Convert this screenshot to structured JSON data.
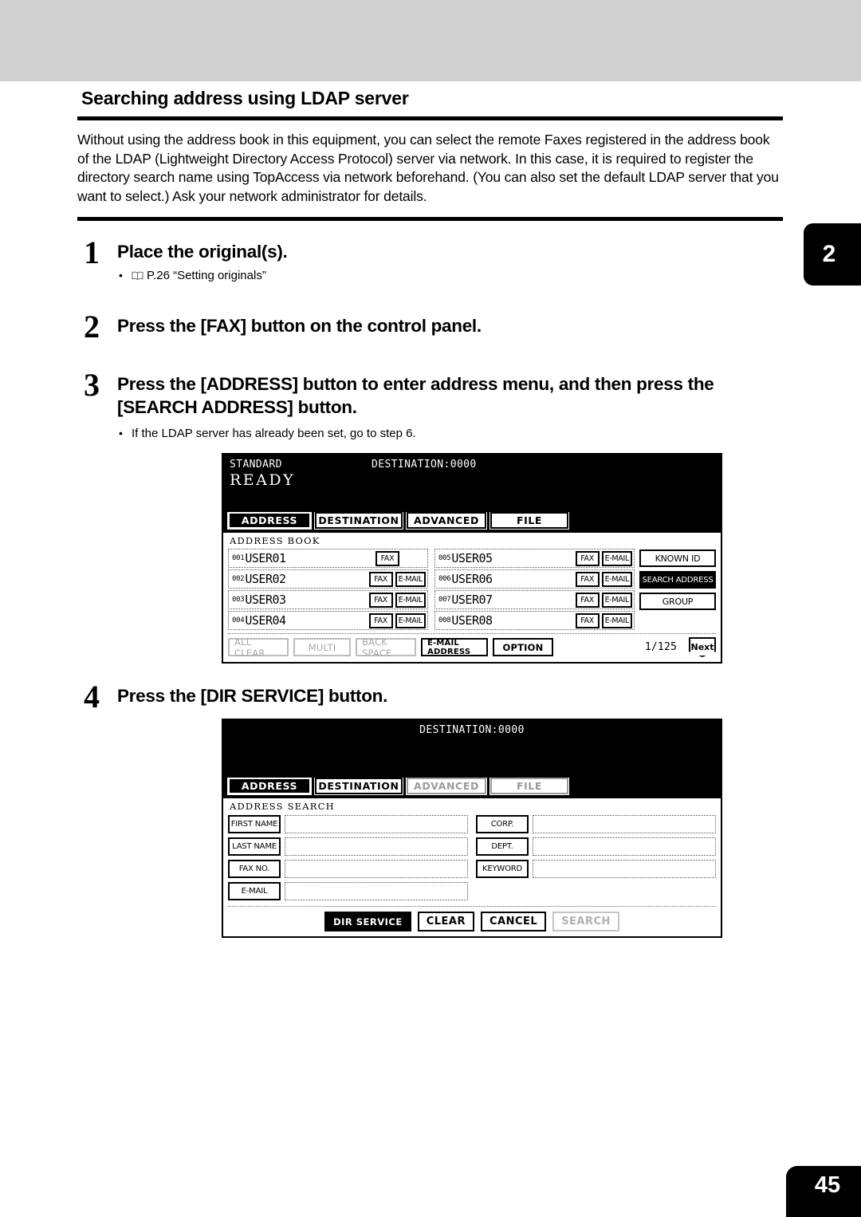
{
  "page": {
    "chapter_tab": "2",
    "page_number": "45"
  },
  "section": {
    "title": "Searching address using LDAP server",
    "intro": "Without using the address book in this equipment, you can select the remote Faxes registered in the address book of the LDAP (Lightweight Directory Access Protocol) server via network. In this case, it is required to register the directory search name using TopAccess via network beforehand. (You can also set the default LDAP server that you want to select.) Ask your network administrator for details."
  },
  "steps": [
    {
      "num": "1",
      "title": "Place the original(s).",
      "bullet": "P.26 “Setting originals”"
    },
    {
      "num": "2",
      "title": "Press the [FAX] button on the control panel."
    },
    {
      "num": "3",
      "title": "Press the [ADDRESS] button to enter address menu, and then press the [SEARCH ADDRESS] button.",
      "bullet": "If the LDAP server has already been set, go to step 6."
    },
    {
      "num": "4",
      "title": "Press the [DIR SERVICE] button."
    }
  ],
  "lcd1": {
    "status_left": "STANDARD",
    "status_mid": "DESTINATION:0000",
    "ready": "READY",
    "tabs": [
      {
        "label": "ADDRESS",
        "state": "selected"
      },
      {
        "label": "DESTINATION",
        "state": "normal"
      },
      {
        "label": "ADVANCED",
        "state": "normal"
      },
      {
        "label": "FILE",
        "state": "normal"
      }
    ],
    "caption": "ADDRESS BOOK",
    "entries_left": [
      {
        "index": "001",
        "name": "USER01",
        "fax": "FAX",
        "email": ""
      },
      {
        "index": "002",
        "name": "USER02",
        "fax": "FAX",
        "email": "E-MAIL"
      },
      {
        "index": "003",
        "name": "USER03",
        "fax": "FAX",
        "email": "E-MAIL"
      },
      {
        "index": "004",
        "name": "USER04",
        "fax": "FAX",
        "email": "E-MAIL"
      }
    ],
    "entries_right": [
      {
        "index": "005",
        "name": "USER05",
        "fax": "FAX",
        "email": "E-MAIL"
      },
      {
        "index": "006",
        "name": "USER06",
        "fax": "FAX",
        "email": "E-MAIL"
      },
      {
        "index": "007",
        "name": "USER07",
        "fax": "FAX",
        "email": "E-MAIL"
      },
      {
        "index": "008",
        "name": "USER08",
        "fax": "FAX",
        "email": "E-MAIL"
      }
    ],
    "side_buttons": [
      {
        "label": "KNOWN ID",
        "state": "normal"
      },
      {
        "label": "SEARCH ADDRESS",
        "state": "selected"
      },
      {
        "label": "GROUP",
        "state": "normal"
      }
    ],
    "foot_buttons": [
      {
        "label": "ALL CLEAR",
        "state": "disabled"
      },
      {
        "label": "MULTI",
        "state": "disabled"
      },
      {
        "label": "BACK SPACE",
        "state": "disabled"
      },
      {
        "label": "E-MAIL ADDRESS",
        "state": "normal"
      },
      {
        "label": "OPTION",
        "state": "normal"
      }
    ],
    "page_count": "1/125",
    "next_label": "Next"
  },
  "lcd2": {
    "status_mid": "DESTINATION:0000",
    "tabs": [
      {
        "label": "ADDRESS",
        "state": "selected"
      },
      {
        "label": "DESTINATION",
        "state": "normal"
      },
      {
        "label": "ADVANCED",
        "state": "disabled"
      },
      {
        "label": "FILE",
        "state": "disabled"
      }
    ],
    "caption": "ADDRESS SEARCH",
    "fields_left": [
      {
        "label": "FIRST NAME",
        "value": ""
      },
      {
        "label": "LAST NAME",
        "value": ""
      },
      {
        "label": "FAX NO.",
        "value": ""
      },
      {
        "label": "E-MAIL",
        "value": ""
      }
    ],
    "fields_right": [
      {
        "label": "CORP.",
        "value": ""
      },
      {
        "label": "DEPT.",
        "value": ""
      },
      {
        "label": "KEYWORD",
        "value": ""
      }
    ],
    "foot_buttons": [
      {
        "label": "DIR SERVICE",
        "state": "selected"
      },
      {
        "label": "CLEAR",
        "state": "normal"
      },
      {
        "label": "CANCEL",
        "state": "normal"
      },
      {
        "label": "SEARCH",
        "state": "disabled"
      }
    ]
  }
}
